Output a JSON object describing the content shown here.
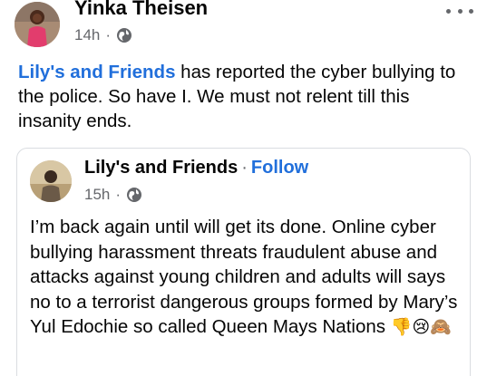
{
  "post": {
    "author": "Yinka Theisen",
    "time": "14h",
    "dot": "·",
    "icons": {
      "privacy": "globe-icon",
      "menu": "more-options-icon"
    },
    "mention": "Lily's and Friends",
    "text_after_mention": " has reported the cyber bullying to the police. So have I. We must not relent till this insanity ends."
  },
  "shared": {
    "author": "Lily's and Friends",
    "separator": "·",
    "follow_label": "Follow",
    "time": "15h",
    "dot": "·",
    "icons": {
      "privacy": "globe-icon"
    },
    "text": "I’m back again until will get its done. Online cyber bullying harassment threats  fraudulent abuse and attacks against young children and adults will says no to a terrorist dangerous groups formed by Mary’s Yul Edochie so called Queen Mays Nations",
    "emojis": [
      "👎",
      "😢",
      "🙈"
    ]
  },
  "colors": {
    "link": "#216fdb",
    "secondary_text": "#65676b",
    "border": "#dadde1"
  }
}
